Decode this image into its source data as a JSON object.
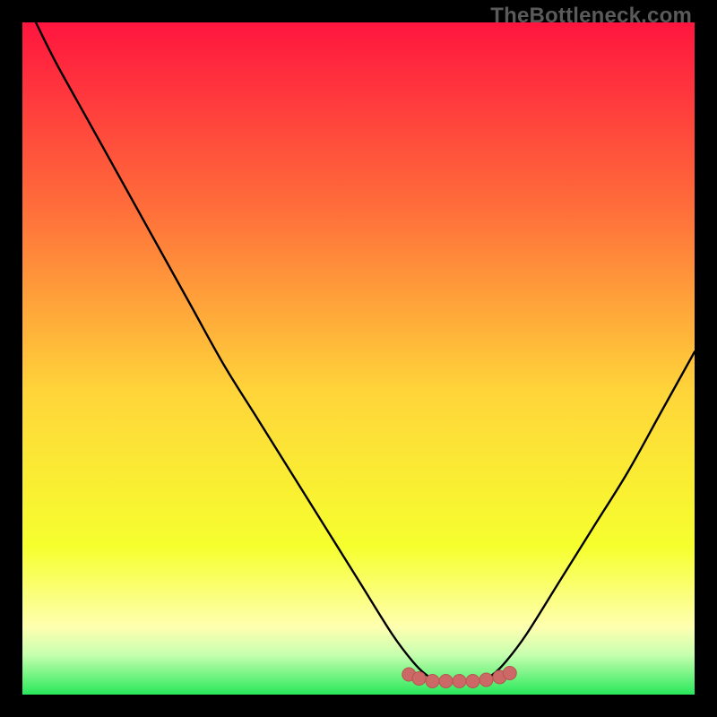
{
  "watermark": "TheBottleneck.com",
  "colors": {
    "frame": "#000000",
    "grad_top": "#ff153f",
    "grad_upper_mid": "#ff6f3a",
    "grad_mid": "#ffd53a",
    "grad_lower_mid": "#f6ff2e",
    "grad_yellow_pale": "#feffb0",
    "grad_green_pale": "#c8ffb0",
    "grad_green": "#28e85a",
    "curve": "#000000",
    "marker": "#cc6966",
    "marker_stroke": "#b75451"
  },
  "chart_data": {
    "type": "line",
    "title": "",
    "xlabel": "",
    "ylabel": "",
    "xlim": [
      0,
      100
    ],
    "ylim": [
      0,
      100
    ],
    "series": [
      {
        "name": "bottleneck-curve",
        "x": [
          2,
          5,
          10,
          15,
          20,
          25,
          30,
          35,
          40,
          45,
          50,
          55,
          58,
          60,
          62,
          65,
          68,
          70,
          72,
          75,
          80,
          85,
          90,
          95,
          100
        ],
        "y": [
          100,
          94,
          85,
          76,
          67,
          58,
          49,
          41,
          33,
          25,
          17,
          9,
          5,
          3,
          2,
          2,
          2,
          3,
          5,
          9,
          17,
          25,
          33,
          42,
          51
        ]
      }
    ],
    "markers": {
      "name": "highlight-band",
      "x": [
        57.5,
        59,
        61,
        63,
        65,
        67,
        69,
        71,
        72.5
      ],
      "y": [
        3.0,
        2.4,
        2.0,
        2.0,
        2.0,
        2.0,
        2.2,
        2.6,
        3.2
      ]
    },
    "annotations": []
  }
}
